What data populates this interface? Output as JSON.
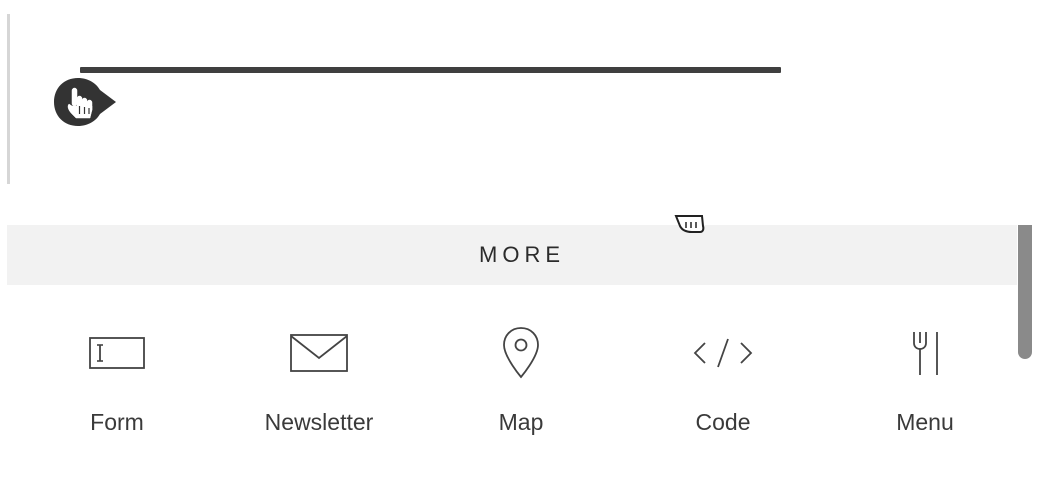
{
  "colors": {
    "divider": "#3f3f3f",
    "handle": "#333333",
    "header_bg": "#f2f2f2",
    "text": "#3a3a3a",
    "icon_stroke": "#444444",
    "scrollbar_thumb": "#8a8a8a"
  },
  "editor": {
    "drag_handle_icon": "hand-pointer-icon"
  },
  "more_panel": {
    "title": "MORE",
    "items": [
      {
        "label": "Form",
        "icon": "form-field-icon"
      },
      {
        "label": "Newsletter",
        "icon": "envelope-icon"
      },
      {
        "label": "Map",
        "icon": "map-pin-icon"
      },
      {
        "label": "Code",
        "icon": "code-icon"
      },
      {
        "label": "Menu",
        "icon": "fork-knife-icon"
      }
    ]
  }
}
